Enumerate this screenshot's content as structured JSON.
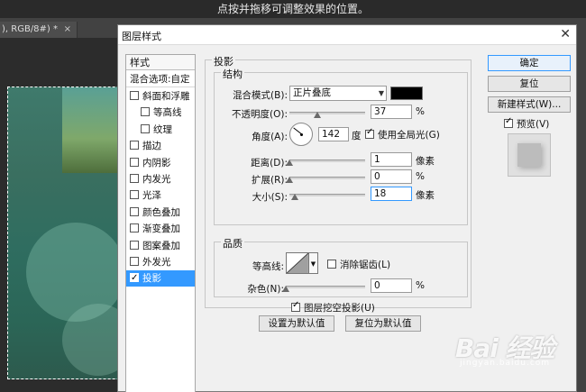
{
  "topbar": {
    "instruction": "点按并拖移可调整效果的位置。"
  },
  "document_tab": {
    "label": "), RGB/8#) *",
    "close": "×"
  },
  "dialog": {
    "title": "图层样式",
    "close": "✕",
    "styles_header": "样式",
    "blending_options": "混合选项:自定",
    "style_items": [
      {
        "label": "斜面和浮雕",
        "checked": false,
        "sub": false,
        "active": false
      },
      {
        "label": "等高线",
        "checked": false,
        "sub": true,
        "active": false
      },
      {
        "label": "纹理",
        "checked": false,
        "sub": true,
        "active": false
      },
      {
        "label": "描边",
        "checked": false,
        "sub": false,
        "active": false
      },
      {
        "label": "内阴影",
        "checked": false,
        "sub": false,
        "active": false
      },
      {
        "label": "内发光",
        "checked": false,
        "sub": false,
        "active": false
      },
      {
        "label": "光泽",
        "checked": false,
        "sub": false,
        "active": false
      },
      {
        "label": "颜色叠加",
        "checked": false,
        "sub": false,
        "active": false
      },
      {
        "label": "渐变叠加",
        "checked": false,
        "sub": false,
        "active": false
      },
      {
        "label": "图案叠加",
        "checked": false,
        "sub": false,
        "active": false
      },
      {
        "label": "外发光",
        "checked": false,
        "sub": false,
        "active": false
      },
      {
        "label": "投影",
        "checked": true,
        "sub": false,
        "active": true
      }
    ]
  },
  "drop_shadow": {
    "group_title": "投影",
    "structure": {
      "title": "结构",
      "blend_mode_label": "混合模式(B):",
      "blend_mode_value": "正片叠底",
      "shadow_color": "#000000",
      "opacity_label": "不透明度(O):",
      "opacity_value": "37",
      "opacity_unit": "%",
      "angle_label": "角度(A):",
      "angle_value": "142",
      "angle_unit": "度",
      "global_light_label": "使用全局光(G)",
      "global_light_checked": true,
      "distance_label": "距离(D):",
      "distance_value": "1",
      "distance_unit": "像素",
      "spread_label": "扩展(R):",
      "spread_value": "0",
      "spread_unit": "%",
      "size_label": "大小(S):",
      "size_value": "18",
      "size_unit": "像素"
    },
    "quality": {
      "title": "品质",
      "contour_label": "等高线:",
      "antialias_label": "消除锯齿(L)",
      "antialias_checked": false,
      "noise_label": "杂色(N):",
      "noise_value": "0",
      "noise_unit": "%"
    },
    "knockout_label": "图层挖空投影(U)",
    "knockout_checked": true,
    "make_default_label": "设置为默认值",
    "reset_default_label": "复位为默认值"
  },
  "right_buttons": {
    "ok_label": "确定",
    "reset_label": "复位",
    "new_style_label": "新建样式(W)...",
    "preview_label": "预览(V)",
    "preview_checked": true
  },
  "watermark": {
    "logo": "Bai 经验",
    "url": "jingyan.baidu.com"
  },
  "accent_color": "#3399ff"
}
